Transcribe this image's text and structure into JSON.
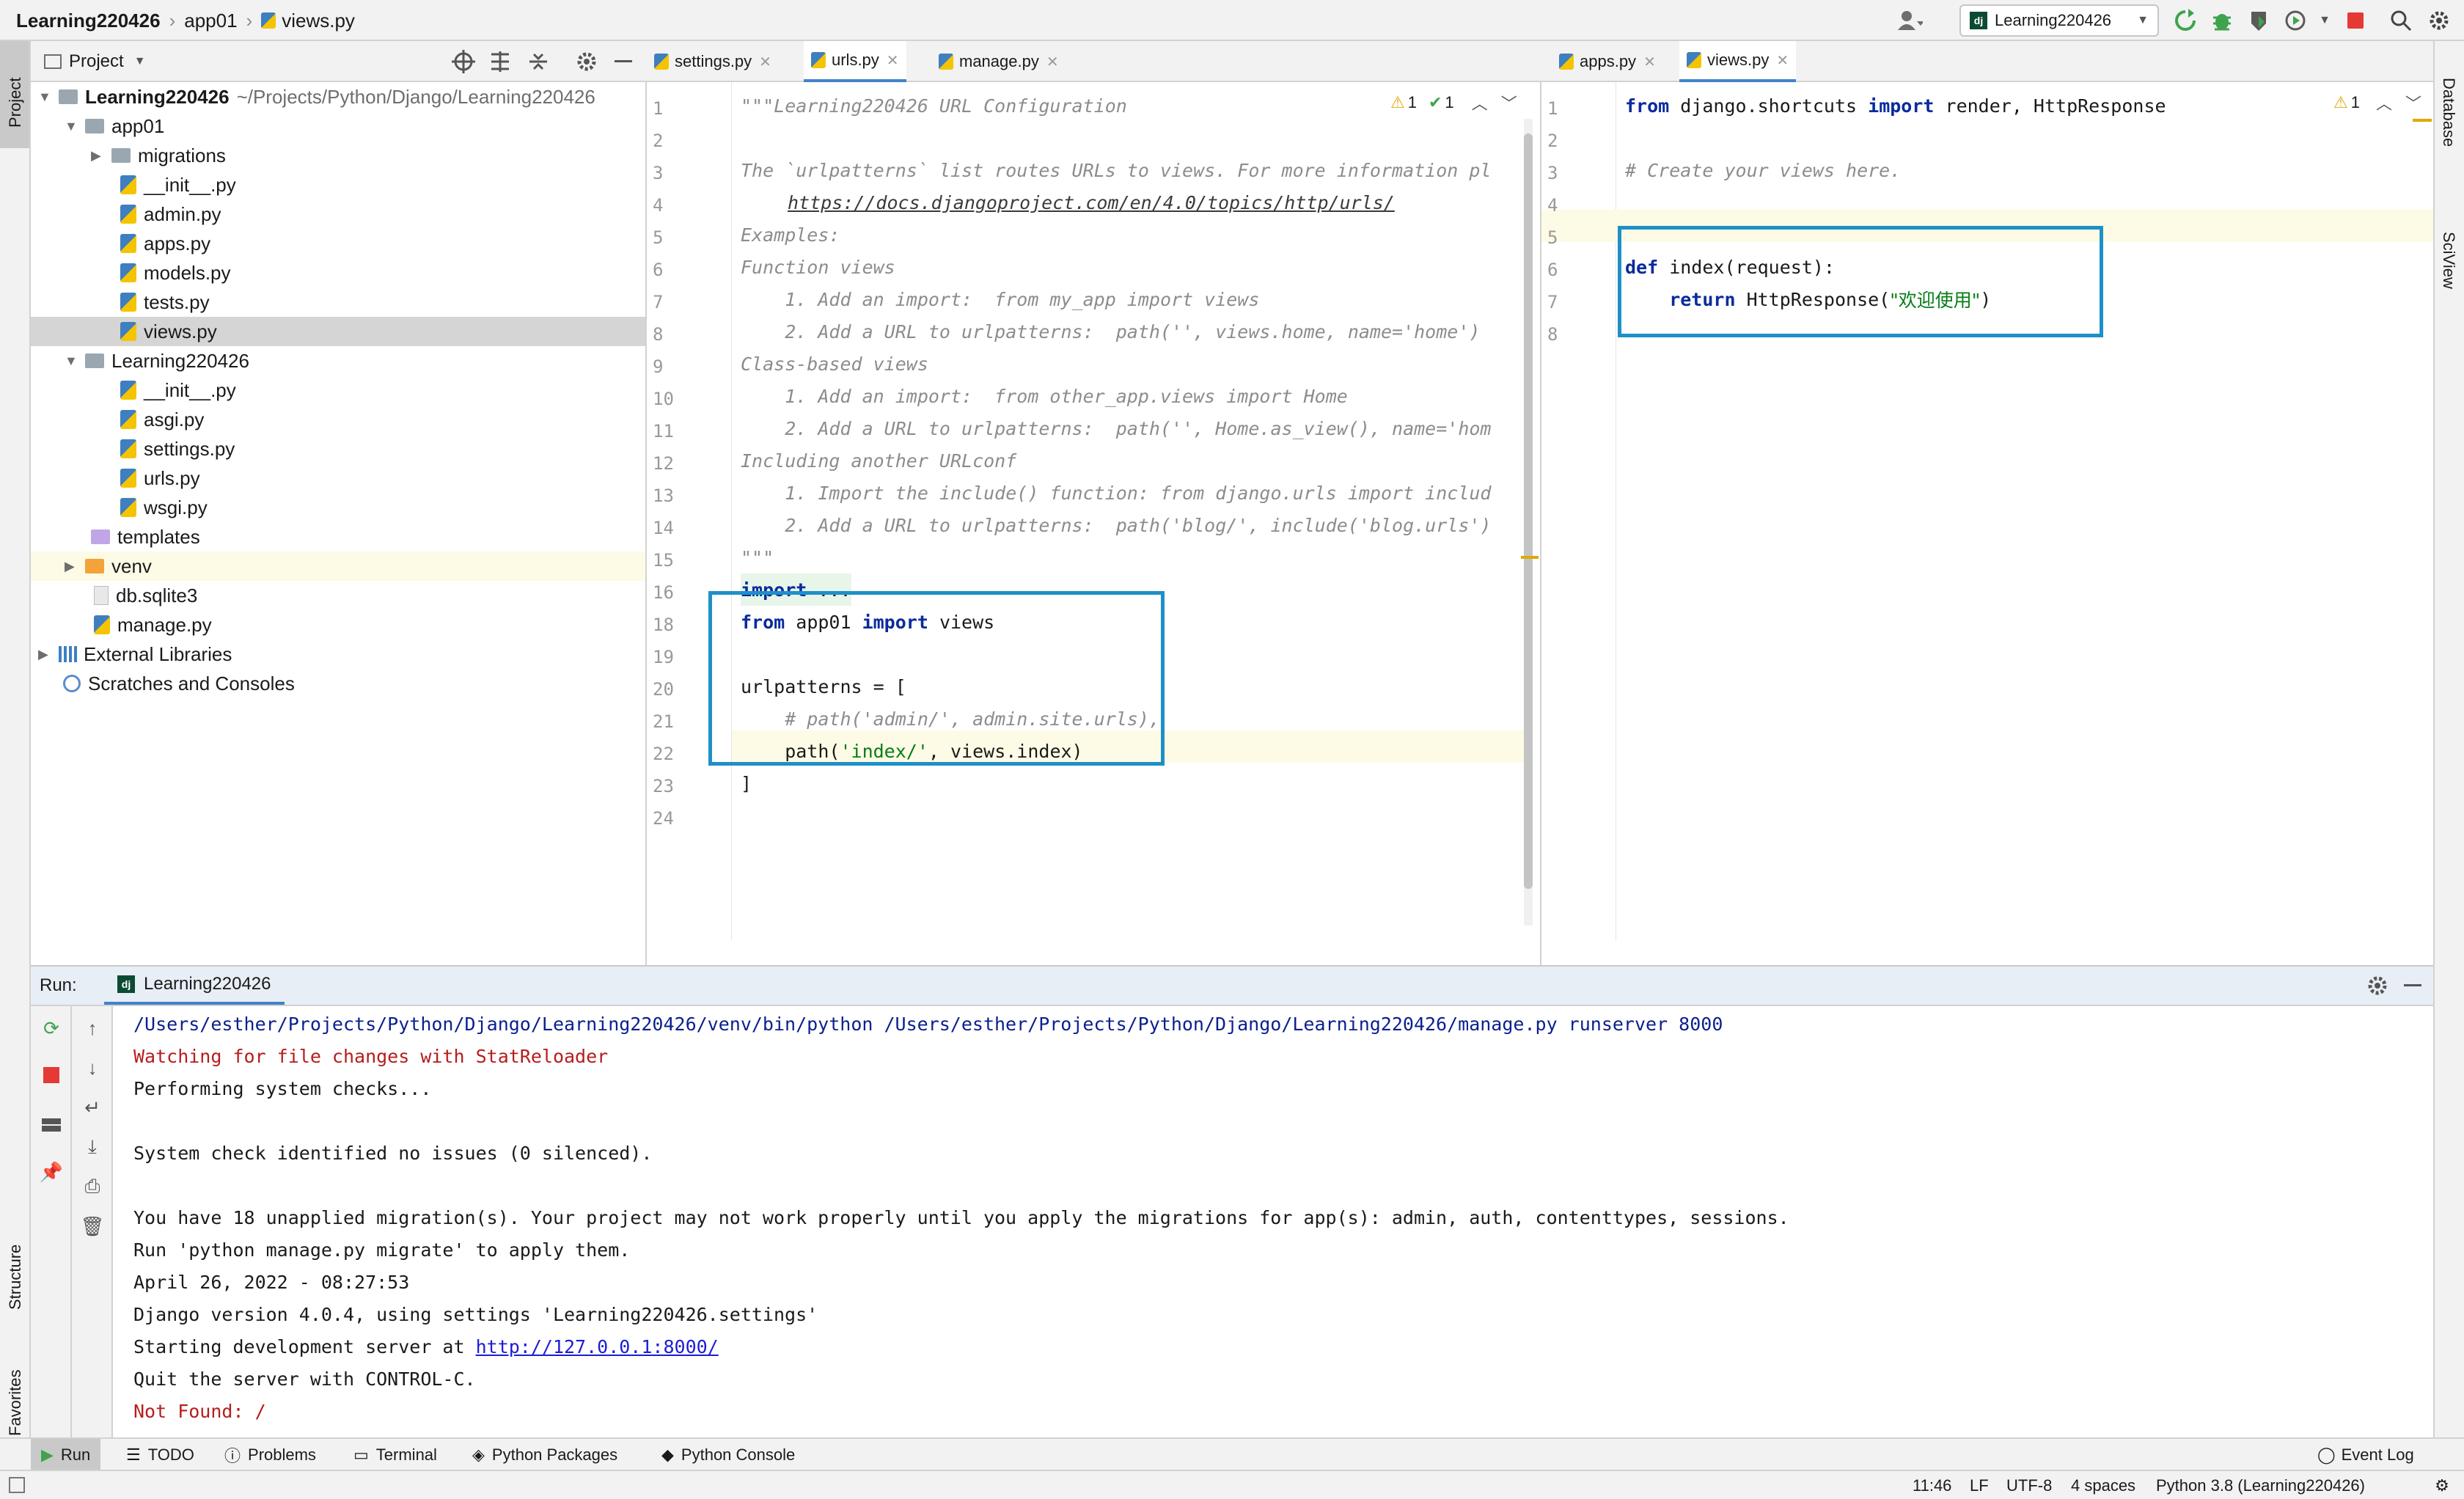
{
  "navbar": {
    "project": "Learning220426",
    "module": "app01",
    "file": "views.py",
    "run_config": "Learning220426"
  },
  "left_stripe": {
    "project": "Project",
    "structure": "Structure",
    "favorites": "Favorites"
  },
  "right_stripe": {
    "database": "Database",
    "sciview": "SciView"
  },
  "project_panel": {
    "title": "Project",
    "tree": [
      {
        "label": "Learning220426",
        "path": "~/Projects/Python/Django/Learning220426"
      },
      {
        "label": "app01"
      },
      {
        "label": "migrations"
      },
      {
        "label": "__init__.py"
      },
      {
        "label": "admin.py"
      },
      {
        "label": "apps.py"
      },
      {
        "label": "models.py"
      },
      {
        "label": "tests.py"
      },
      {
        "label": "views.py"
      },
      {
        "label": "Learning220426"
      },
      {
        "label": "__init__.py"
      },
      {
        "label": "asgi.py"
      },
      {
        "label": "settings.py"
      },
      {
        "label": "urls.py"
      },
      {
        "label": "wsgi.py"
      },
      {
        "label": "templates"
      },
      {
        "label": "venv"
      },
      {
        "label": "db.sqlite3"
      },
      {
        "label": "manage.py"
      },
      {
        "label": "External Libraries"
      },
      {
        "label": "Scratches and Consoles"
      }
    ]
  },
  "editor_left": {
    "tabs": [
      "settings.py",
      "urls.py",
      "manage.py"
    ],
    "inspection": {
      "warnings": "1",
      "ok": "1"
    },
    "line_numbers": [
      "1",
      "2",
      "3",
      "4",
      "5",
      "6",
      "7",
      "8",
      "9",
      "10",
      "11",
      "12",
      "13",
      "14",
      "15",
      "16",
      "18",
      "19",
      "20",
      "21",
      "22",
      "23",
      "24"
    ],
    "lines": {
      "l1": "\"\"\"Learning220426 URL Configuration",
      "l3": "The `urlpatterns` list routes URLs to views. For more information pl",
      "l4": "https://docs.djangoproject.com/en/4.0/topics/http/urls/",
      "l5": "Examples:",
      "l6": "Function views",
      "l7": "    1. Add an import:  from my_app import views",
      "l8": "    2. Add a URL to urlpatterns:  path('', views.home, name='home')",
      "l9": "Class-based views",
      "l10": "    1. Add an import:  from other_app.views import Home",
      "l11": "    2. Add a URL to urlpatterns:  path('', Home.as_view(), name='hom",
      "l12": "Including another URLconf",
      "l13": "    1. Import the include() function: from django.urls import includ",
      "l14": "    2. Add a URL to urlpatterns:  path('blog/', include('blog.urls')",
      "l15": "\"\"\"",
      "l16_kw": "import",
      "l16_rest": " ...",
      "l18_kw1": "from",
      "l18_mid": " app01 ",
      "l18_kw2": "import",
      "l18_rest": " views",
      "l20": "urlpatterns = [",
      "l21": "    # path('admin/', admin.site.urls),",
      "l22_a": "    path(",
      "l22_s": "'index/'",
      "l22_b": ", views.index)",
      "l23": "]"
    }
  },
  "editor_right": {
    "tabs": [
      "apps.py",
      "views.py"
    ],
    "inspection": {
      "warnings": "1"
    },
    "line_numbers": [
      "1",
      "2",
      "3",
      "4",
      "5",
      "6",
      "7",
      "8"
    ],
    "lines": {
      "l1_kw1": "from",
      "l1_mid": " django.shortcuts ",
      "l1_kw2": "import",
      "l1_rest": " render, HttpResponse",
      "l3": "# Create your views here.",
      "l6_kw": "def",
      "l6_rest": " index(request):",
      "l7_kw": "    return",
      "l7_a": " HttpResponse(",
      "l7_s": "\"欢迎使用\"",
      "l7_b": ")"
    }
  },
  "run_panel": {
    "label": "Run:",
    "tab": "Learning220426",
    "console": [
      "/Users/esther/Projects/Python/Django/Learning220426/venv/bin/python /Users/esther/Projects/Python/Django/Learning220426/manage.py runserver 8000",
      "Watching for file changes with StatReloader",
      "Performing system checks...",
      "",
      "System check identified no issues (0 silenced).",
      "",
      "You have 18 unapplied migration(s). Your project may not work properly until you apply the migrations for app(s): admin, auth, contenttypes, sessions.",
      "Run 'python manage.py migrate' to apply them.",
      "April 26, 2022 - 08:27:53",
      "Django version 4.0.4, using settings 'Learning220426.settings'",
      "Starting development server at ",
      "Quit the server with CONTROL-C.",
      "Not Found: /"
    ],
    "server_url": "http://127.0.0.1:8000/"
  },
  "bottom_tools": [
    "Run",
    "TODO",
    "Problems",
    "Terminal",
    "Python Packages",
    "Python Console"
  ],
  "event_log": "Event Log",
  "status_bar": {
    "position": "11:46",
    "line_sep": "LF",
    "encoding": "UTF-8",
    "indent": "4 spaces",
    "interpreter": "Python 3.8 (Learning220426)"
  },
  "colors": {
    "accent": "#1e90c8",
    "keyword": "#0a2b9c",
    "string": "#067d17",
    "error": "#b71c1c",
    "stop": "#e53935",
    "run": "#3fa34d"
  }
}
